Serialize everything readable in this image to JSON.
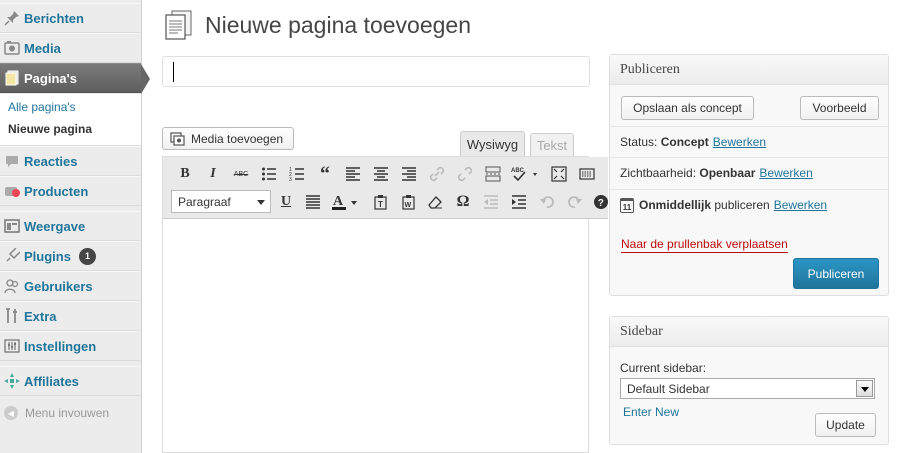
{
  "sidebar": {
    "items": [
      {
        "label": "Berichten",
        "icon": "pin-icon"
      },
      {
        "label": "Media",
        "icon": "media-icon"
      },
      {
        "label": "Pagina's",
        "icon": "pages-icon"
      },
      {
        "label": "Reacties",
        "icon": "comment-icon"
      },
      {
        "label": "Producten",
        "icon": "products-icon"
      },
      {
        "label": "Weergave",
        "icon": "appearance-icon"
      },
      {
        "label": "Plugins",
        "icon": "plugin-icon",
        "badge": "1"
      },
      {
        "label": "Gebruikers",
        "icon": "users-icon"
      },
      {
        "label": "Extra",
        "icon": "tools-icon"
      },
      {
        "label": "Instellingen",
        "icon": "settings-icon"
      },
      {
        "label": "Affiliates",
        "icon": "affiliates-icon"
      }
    ],
    "submenu": {
      "all_pages": "Alle pagina's",
      "new_page": "Nieuwe pagina"
    },
    "collapse_label": "Menu invouwen"
  },
  "header": {
    "title": "Nieuwe pagina toevoegen"
  },
  "editor": {
    "title_value": "",
    "media_button": "Media toevoegen",
    "tabs": {
      "visual": "Wysiwyg",
      "text": "Tekst"
    },
    "format_select": "Paragraaf",
    "toolbar_row1": [
      "bold-icon",
      "italic-icon",
      "strikethrough-icon",
      "bullet-list-icon",
      "numbered-list-icon",
      "blockquote-icon",
      "align-left-icon",
      "align-center-icon",
      "align-right-icon",
      "link-icon",
      "unlink-icon",
      "more-tag-icon",
      "spellcheck-icon",
      "fullscreen-icon",
      "kitchen-sink-icon"
    ],
    "toolbar_row2": [
      "underline-icon",
      "justify-icon",
      "text-color-icon",
      "paste-text-icon",
      "paste-word-icon",
      "clear-format-icon",
      "special-char-icon",
      "outdent-icon",
      "indent-icon",
      "undo-icon",
      "redo-icon",
      "help-icon"
    ],
    "toolbar_labels": {
      "bold": "B",
      "italic": "I",
      "strike": "ABC",
      "quote": "“",
      "underline": "U",
      "text_color": "A",
      "omega": "Ω",
      "help": "?"
    }
  },
  "publish": {
    "title": "Publiceren",
    "save_draft": "Opslaan als concept",
    "preview": "Voorbeeld",
    "status_label": "Status:",
    "status_value": "Concept",
    "edit_link": "Bewerken",
    "visibility_label": "Zichtbaarheid:",
    "visibility_value": "Openbaar",
    "schedule_day": "11",
    "schedule_value": "Onmiddellijk",
    "schedule_suffix": "publiceren",
    "trash_link": "Naar de prullenbak verplaatsen",
    "publish_button": "Publiceren"
  },
  "sidebar_box": {
    "title": "Sidebar",
    "current_label": "Current sidebar:",
    "selected": "Default Sidebar",
    "enter_new": "Enter New",
    "update_button": "Update"
  },
  "colors": {
    "link": "#21759b",
    "menu_current": "#6d6d6d",
    "trash": "#bc0b0b",
    "publish_button": "#21759b"
  }
}
